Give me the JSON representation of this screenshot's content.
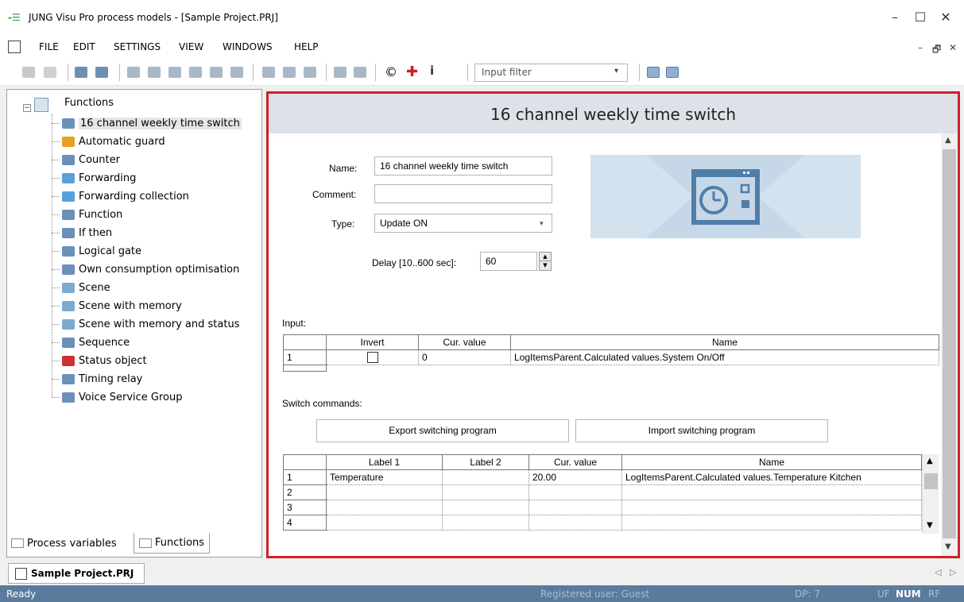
{
  "window": {
    "title": "JUNG Visu Pro process models - [Sample Project.PRJ]",
    "minimize": "–",
    "maximize": "☐",
    "close": "✕"
  },
  "menu": {
    "items": [
      "FILE",
      "EDIT",
      "SETTINGS",
      "VIEW",
      "WINDOWS",
      "HELP"
    ],
    "mdi_min": "–",
    "mdi_restore": "🗗",
    "mdi_close": "✕"
  },
  "toolbar": {
    "filter_placeholder": "Input filter"
  },
  "tree": {
    "root": "Functions",
    "items": [
      {
        "label": "16 channel weekly time switch",
        "icon": "clock-icon",
        "color": "#6b8fb8"
      },
      {
        "label": "Automatic guard",
        "icon": "warning-icon",
        "color": "#e8a020"
      },
      {
        "label": "Counter",
        "icon": "counter-icon",
        "color": "#6b8fb8"
      },
      {
        "label": "Forwarding",
        "icon": "arrow-right-icon",
        "color": "#5aa0d8"
      },
      {
        "label": "Forwarding collection",
        "icon": "arrow-right-icon",
        "color": "#5aa0d8"
      },
      {
        "label": "Function",
        "icon": "math-icon",
        "color": "#6b8fb8"
      },
      {
        "label": "If then",
        "icon": "branch-icon",
        "color": "#6b8fb8"
      },
      {
        "label": "Logical gate",
        "icon": "gate-icon",
        "color": "#6b8fb8"
      },
      {
        "label": "Own consumption optimisation",
        "icon": "clock-icon",
        "color": "#6b8fb8"
      },
      {
        "label": "Scene",
        "icon": "scene-icon",
        "color": "#7fa8d0"
      },
      {
        "label": "Scene with memory",
        "icon": "scene-icon",
        "color": "#7fa8d0"
      },
      {
        "label": "Scene with memory and status",
        "icon": "scene-icon",
        "color": "#7fa8d0"
      },
      {
        "label": "Sequence",
        "icon": "sequence-icon",
        "color": "#6b8fb8"
      },
      {
        "label": "Status object",
        "icon": "status-icon",
        "color": "#d03030"
      },
      {
        "label": "Timing relay",
        "icon": "timer-icon",
        "color": "#6b8fb8"
      },
      {
        "label": "Voice Service Group",
        "icon": "voice-icon",
        "color": "#6b8fb8"
      }
    ]
  },
  "left_tabs": {
    "process_variables": "Process variables",
    "functions": "Functions"
  },
  "detail": {
    "header": "16 channel weekly time switch",
    "name_label": "Name:",
    "name_value": "16 channel weekly time switch",
    "comment_label": "Comment:",
    "comment_value": "",
    "type_label": "Type:",
    "type_value": "Update ON",
    "delay_label": "Delay [10..600 sec]:",
    "delay_value": "60",
    "input_label": "Input:",
    "input_headers": [
      "",
      "Invert",
      "Cur. value",
      "Name"
    ],
    "input_rows": [
      {
        "n": "1",
        "value": "0",
        "name": "LogItemsParent.Calculated values.System On/Off"
      }
    ],
    "switch_label": "Switch commands:",
    "export_button": "Export switching program",
    "import_button": "Import switching program",
    "switch_headers": [
      "",
      "Label 1",
      "Label 2",
      "Cur. value",
      "Name"
    ],
    "switch_rows": [
      {
        "n": "1",
        "label1": "Temperature",
        "label2": "",
        "value": "20.00",
        "name": "LogItemsParent.Calculated values.Temperature Kitchen"
      },
      {
        "n": "2",
        "label1": "",
        "label2": "",
        "value": "",
        "name": ""
      },
      {
        "n": "3",
        "label1": "",
        "label2": "",
        "value": "",
        "name": ""
      },
      {
        "n": "4",
        "label1": "",
        "label2": "",
        "value": "",
        "name": ""
      }
    ]
  },
  "doc_tab": "Sample Project.PRJ",
  "status": {
    "ready": "Ready",
    "user": "Registered user: Guest",
    "dp": "DP: 7",
    "uf": "UF",
    "num": "NUM",
    "rf": "RF"
  },
  "colors": {
    "status_bar": "#5b7b9d",
    "highlight_border": "#d0202a",
    "header_bg": "#dde2e8"
  }
}
